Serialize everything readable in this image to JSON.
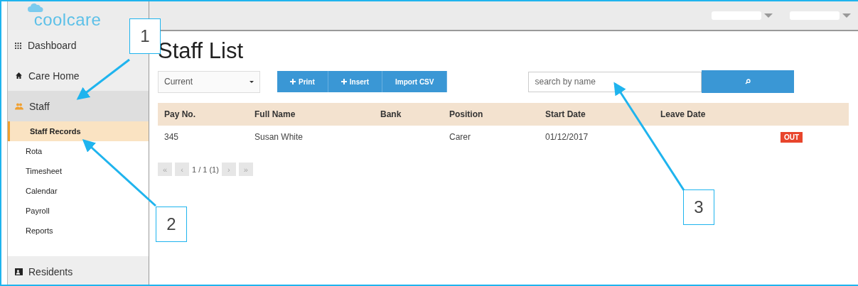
{
  "logo": "coolcare",
  "sidebar": {
    "items": [
      {
        "label": "Dashboard",
        "selected": false
      },
      {
        "label": "Care Home",
        "selected": false
      },
      {
        "label": "Staff",
        "selected": true,
        "children": [
          {
            "label": "Staff Records",
            "selected": true
          },
          {
            "label": "Rota",
            "selected": false
          },
          {
            "label": "Timesheet",
            "selected": false
          },
          {
            "label": "Calendar",
            "selected": false
          },
          {
            "label": "Payroll",
            "selected": false
          },
          {
            "label": "Reports",
            "selected": false
          }
        ]
      },
      {
        "label": "Residents",
        "selected": false
      }
    ]
  },
  "page_title": "Staff List",
  "filter": {
    "value": "Current"
  },
  "buttons": [
    {
      "label": "Print"
    },
    {
      "label": "Insert"
    },
    {
      "label": "Import CSV"
    }
  ],
  "search": {
    "placeholder": "search by name"
  },
  "table": {
    "columns": [
      "Pay No.",
      "Full Name",
      "Bank",
      "Position",
      "Start Date",
      "Leave Date"
    ],
    "rows": [
      {
        "cells": [
          "345",
          "Susan White",
          "",
          "Carer",
          "01/12/2017",
          ""
        ],
        "status": {
          "label": "OUT",
          "color": "#e8452c"
        }
      }
    ]
  },
  "pagination": [
    {
      "label": "«",
      "kind": "button",
      "disabled": true
    },
    {
      "label": "‹",
      "kind": "button",
      "disabled": true
    },
    {
      "label": "1 / 1 (1)",
      "kind": "text"
    },
    {
      "label": "›",
      "kind": "button",
      "disabled": true
    },
    {
      "label": "»",
      "kind": "button",
      "disabled": true
    }
  ],
  "callouts": [
    {
      "label": "1"
    },
    {
      "label": "2"
    },
    {
      "label": "3"
    }
  ]
}
